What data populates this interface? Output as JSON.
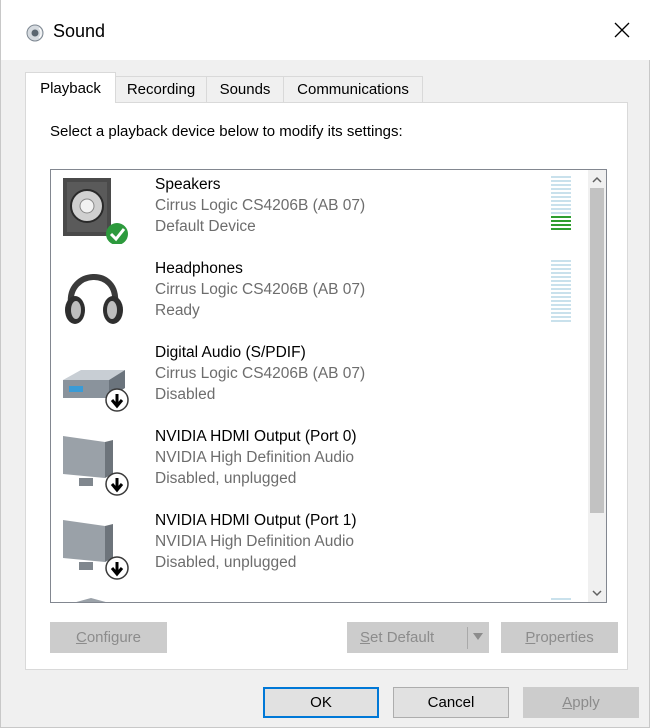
{
  "window": {
    "title": "Sound",
    "title_icon": "speaker-icon",
    "close_icon": "close-icon"
  },
  "tabs": [
    {
      "label": "Playback",
      "active": true
    },
    {
      "label": "Recording",
      "active": false
    },
    {
      "label": "Sounds",
      "active": false
    },
    {
      "label": "Communications",
      "active": false
    }
  ],
  "panel": {
    "instruction": "Select a playback device below to modify its settings:",
    "devices": [
      {
        "name": "Speakers",
        "driver": "Cirrus Logic CS4206B (AB 07)",
        "status": "Default Device",
        "icon": "speaker-icon",
        "badge": "check-icon",
        "meter_level": 0.25
      },
      {
        "name": "Headphones",
        "driver": "Cirrus Logic CS4206B (AB 07)",
        "status": "Ready",
        "icon": "headphones-icon",
        "badge": "",
        "meter_level": 0
      },
      {
        "name": "Digital Audio (S/PDIF)",
        "driver": "Cirrus Logic CS4206B (AB 07)",
        "status": "Disabled",
        "icon": "digital-audio-icon",
        "badge": "down-arrow-icon"
      },
      {
        "name": "NVIDIA HDMI Output (Port 0)",
        "driver": "NVIDIA High Definition Audio",
        "status": "Disabled, unplugged",
        "icon": "monitor-icon",
        "badge": "down-arrow-icon"
      },
      {
        "name": "NVIDIA HDMI Output (Port 1)",
        "driver": "NVIDIA High Definition Audio",
        "status": "Disabled, unplugged",
        "icon": "monitor-icon",
        "badge": "down-arrow-icon"
      }
    ],
    "configure_hotkey": "C",
    "configure_rest": "onfigure",
    "set_default_hotkey": "S",
    "set_default_rest": "et Default",
    "properties_hotkey": "P",
    "properties_rest": "roperties"
  },
  "footer": {
    "ok": "OK",
    "cancel": "Cancel",
    "apply_hotkey": "A",
    "apply_rest": "pply"
  },
  "colors": {
    "accent": "#0078d7",
    "check": "#2d9a3d",
    "meter_active": "#2f9e2f",
    "meter_idle": "#c9e1ec"
  }
}
